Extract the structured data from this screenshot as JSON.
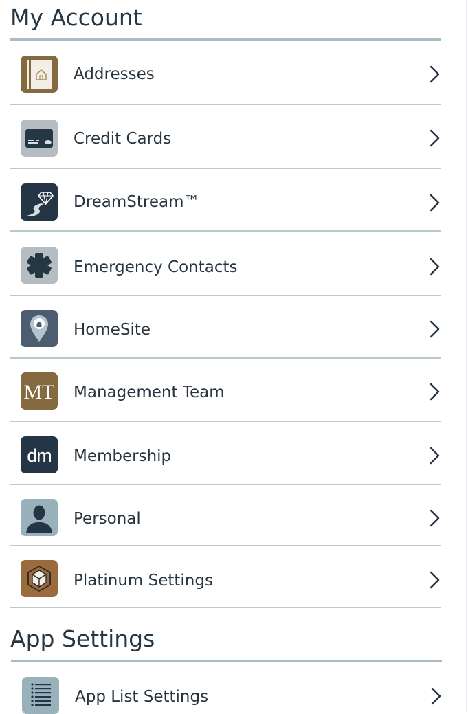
{
  "sections": {
    "my_account": {
      "title": "My Account",
      "items": [
        {
          "label": "Addresses",
          "icon": "address-book-icon",
          "icon_color": "#85693f"
        },
        {
          "label": "Credit Cards",
          "icon": "credit-card-icon",
          "icon_color": "#b5bcc2"
        },
        {
          "label": "DreamStream™",
          "icon": "dreamstream-icon",
          "icon_color": "#243646"
        },
        {
          "label": "Emergency Contacts",
          "icon": "medical-star-icon",
          "icon_color": "#b5bcc2"
        },
        {
          "label": "HomeSite",
          "icon": "home-pin-icon",
          "icon_color": "#4b5d6e"
        },
        {
          "label": "Management Team",
          "icon": "mt-logo-icon",
          "icon_color": "#85693f",
          "icon_text": "MT"
        },
        {
          "label": "Membership",
          "icon": "dm-logo-icon",
          "icon_color": "#243646",
          "icon_text": "dm"
        },
        {
          "label": "Personal",
          "icon": "person-icon",
          "icon_color": "#98b1bb"
        },
        {
          "label": "Platinum Settings",
          "icon": "platinum-cube-icon",
          "icon_color": "#9a6b3c"
        }
      ]
    },
    "app_settings": {
      "title": "App Settings",
      "items": [
        {
          "label": "App List Settings",
          "icon": "list-settings-icon",
          "icon_color": "#98b1bb"
        }
      ]
    }
  },
  "colors": {
    "text": "#283540",
    "divider": "#b8c9d0",
    "section_rule": "#a9bcc6",
    "chevron": "#283540"
  }
}
